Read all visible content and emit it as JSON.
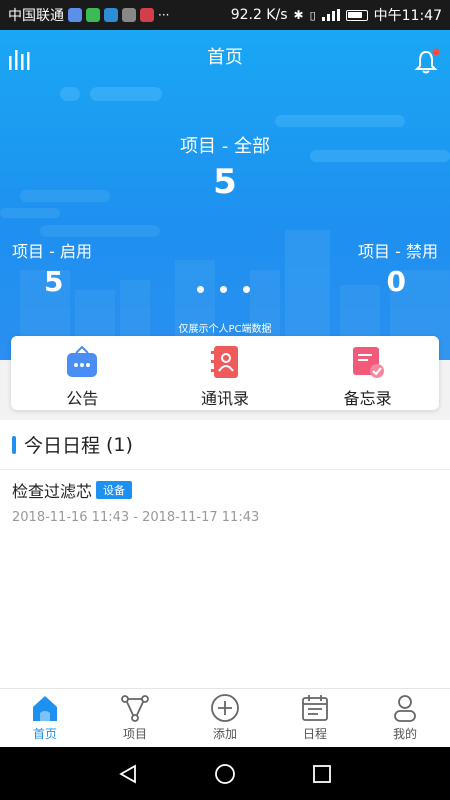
{
  "status_bar": {
    "carrier": "中国联通",
    "speed": "92.2 K/s",
    "time": "中午11:47"
  },
  "header": {
    "title": "首页"
  },
  "stats": {
    "total_label": "项目 - 全部",
    "total_value": "5",
    "enabled_label": "项目 - 启用",
    "enabled_value": "5",
    "disabled_label": "项目 - 禁用",
    "disabled_value": "0",
    "pc_note": "仅展示个人PC端数据"
  },
  "quick_actions": [
    {
      "label": "公告",
      "icon": "announcement-icon"
    },
    {
      "label": "通讯录",
      "icon": "contacts-book-icon"
    },
    {
      "label": "备忘录",
      "icon": "memo-icon"
    }
  ],
  "schedule": {
    "title": "今日日程",
    "count": "(1)",
    "events": [
      {
        "title": "检查过滤芯",
        "tag": "设备",
        "time": "2018-11-16 11:43 - 2018-11-17 11:43"
      }
    ]
  },
  "bottom_nav": [
    {
      "label": "首页",
      "icon": "home-icon",
      "active": true
    },
    {
      "label": "项目",
      "icon": "project-icon",
      "active": false
    },
    {
      "label": "添加",
      "icon": "add-circle-icon",
      "active": false
    },
    {
      "label": "日程",
      "icon": "calendar-icon",
      "active": false
    },
    {
      "label": "我的",
      "icon": "profile-icon",
      "active": false
    }
  ],
  "colors": {
    "primary": "#1e90f0",
    "hero_top": "#1aa7f4",
    "notification_dot": "#ff4d3a"
  }
}
